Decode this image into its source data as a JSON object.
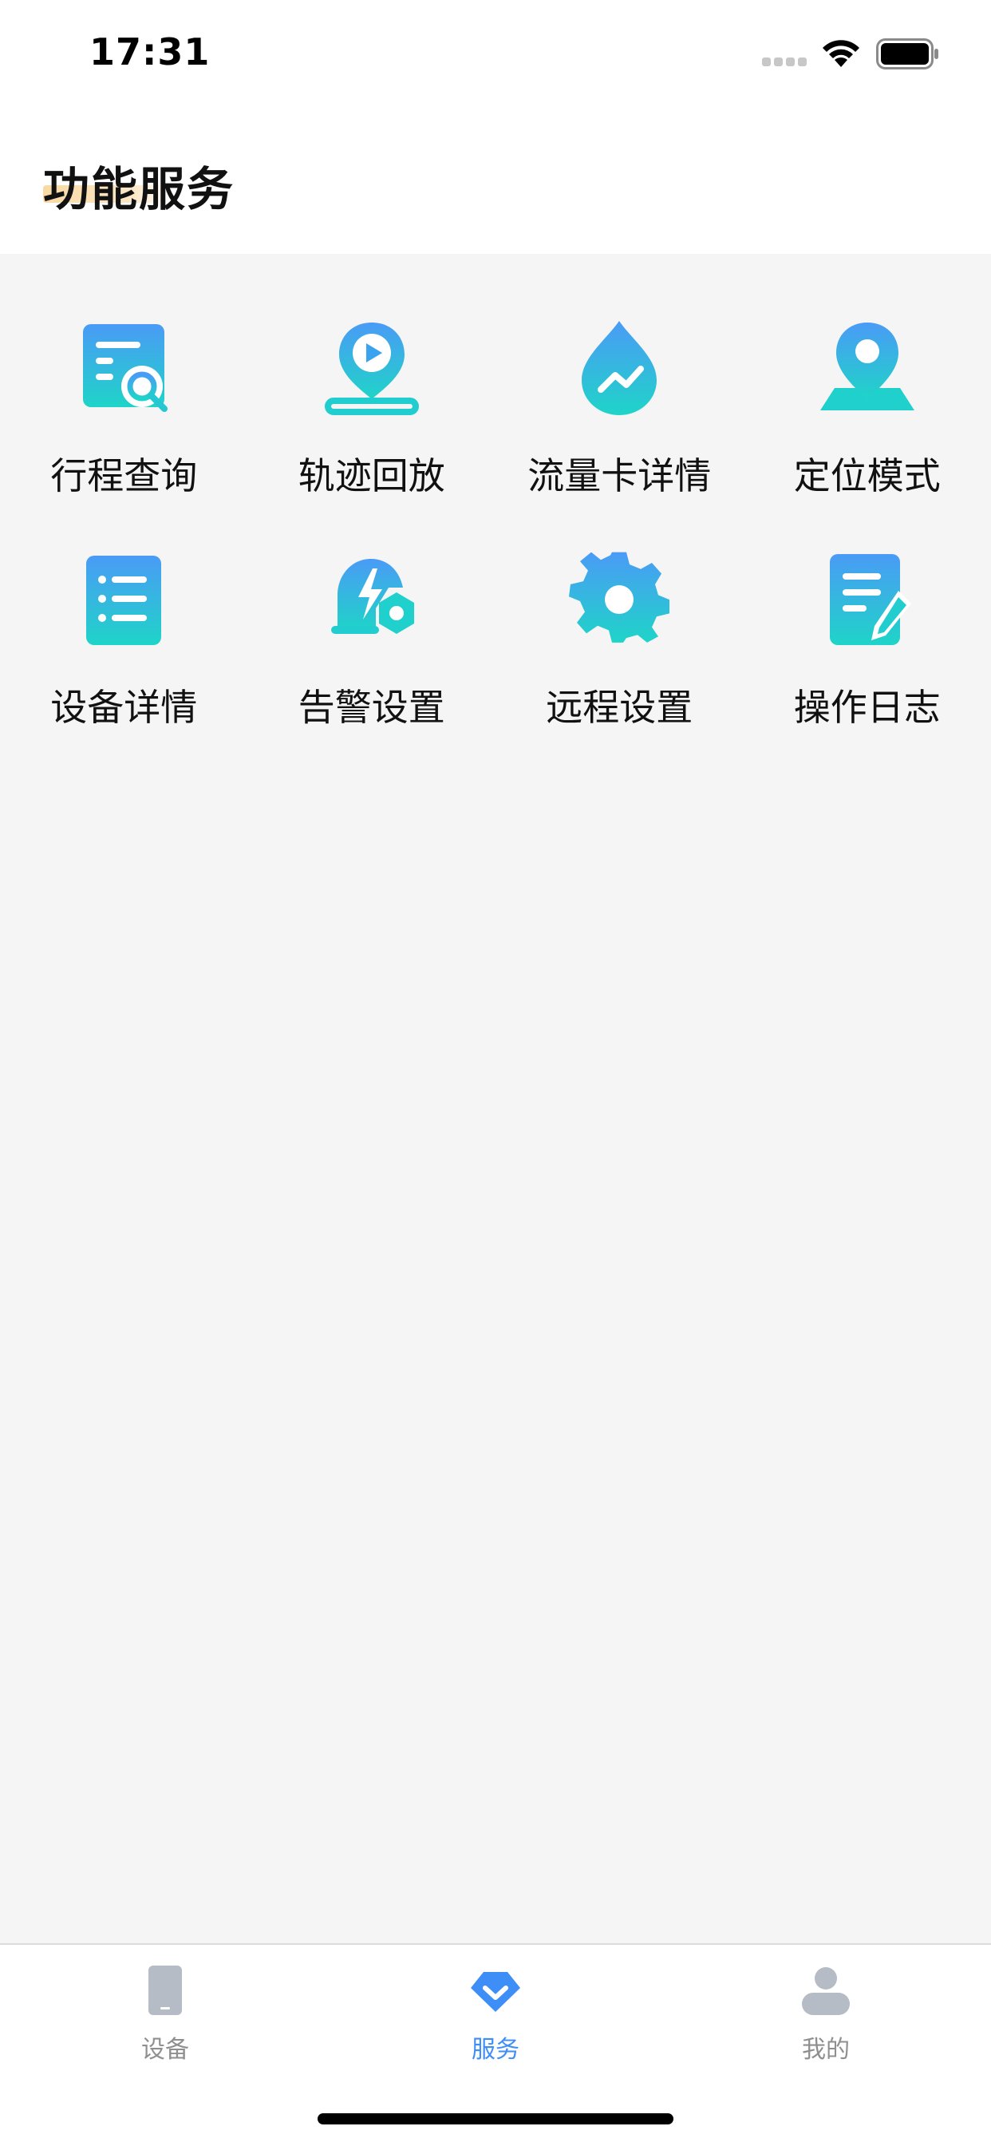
{
  "status_bar": {
    "time": "17:31",
    "signal_icon": "signal-dots-icon",
    "wifi_icon": "wifi-icon",
    "battery_icon": "battery-icon"
  },
  "header": {
    "title": "功能服务",
    "highlight_color": "#f8d9a4"
  },
  "colors": {
    "icon_gradient_top": "#4a9bf6",
    "icon_gradient_bottom": "#1fd4c8",
    "active_tab": "#3e8ef7",
    "inactive_tab": "#b5bcc5",
    "background": "#f5f5f5"
  },
  "services": [
    {
      "label": "行程查询",
      "icon": "trip-search-icon"
    },
    {
      "label": "轨迹回放",
      "icon": "track-playback-icon"
    },
    {
      "label": "流量卡详情",
      "icon": "data-card-icon"
    },
    {
      "label": "定位模式",
      "icon": "location-mode-icon"
    },
    {
      "label": "设备详情",
      "icon": "device-details-icon"
    },
    {
      "label": "告警设置",
      "icon": "alarm-settings-icon"
    },
    {
      "label": "远程设置",
      "icon": "remote-settings-icon"
    },
    {
      "label": "操作日志",
      "icon": "operation-log-icon"
    }
  ],
  "tab_bar": {
    "tabs": [
      {
        "label": "设备",
        "icon": "phone-device-icon",
        "active": false
      },
      {
        "label": "服务",
        "icon": "service-chevron-icon",
        "active": true
      },
      {
        "label": "我的",
        "icon": "user-profile-icon",
        "active": false
      }
    ]
  }
}
